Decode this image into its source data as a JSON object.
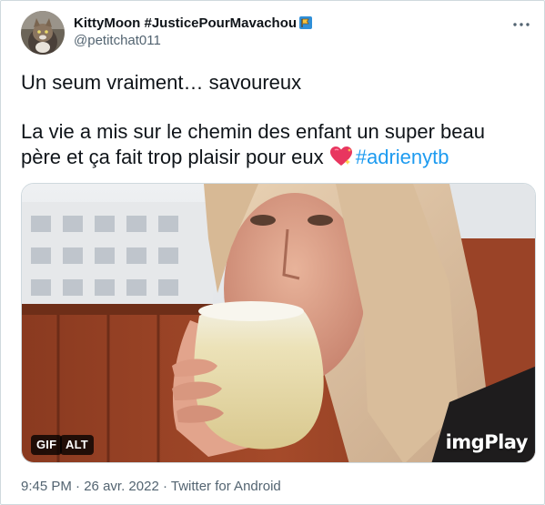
{
  "author": {
    "display_name": "KittyMoon #JusticePourMavachou",
    "handle": "@petitchat011"
  },
  "tweet": {
    "line1": "Un seum vraiment… savoureux",
    "line2": "La vie a mis sur le chemin des enfant un super beau",
    "line3_text": "père et ça fait trop plaisir pour eux",
    "hashtag": "#adrienytb"
  },
  "media": {
    "gif_badge": "GIF",
    "alt_badge": "ALT",
    "watermark": "imgPlay"
  },
  "meta": {
    "time": "9:45 PM",
    "separator": "·",
    "date": "26 avr. 2022",
    "source": "Twitter for Android"
  },
  "icons": {
    "more": "more-options-icon",
    "flag": "flag-emoji-icon",
    "heart": "sparkling-heart-icon"
  },
  "colors": {
    "text": "#0f1419",
    "secondary": "#536471",
    "link": "#1d9bf0",
    "border": "#cfd9de"
  }
}
